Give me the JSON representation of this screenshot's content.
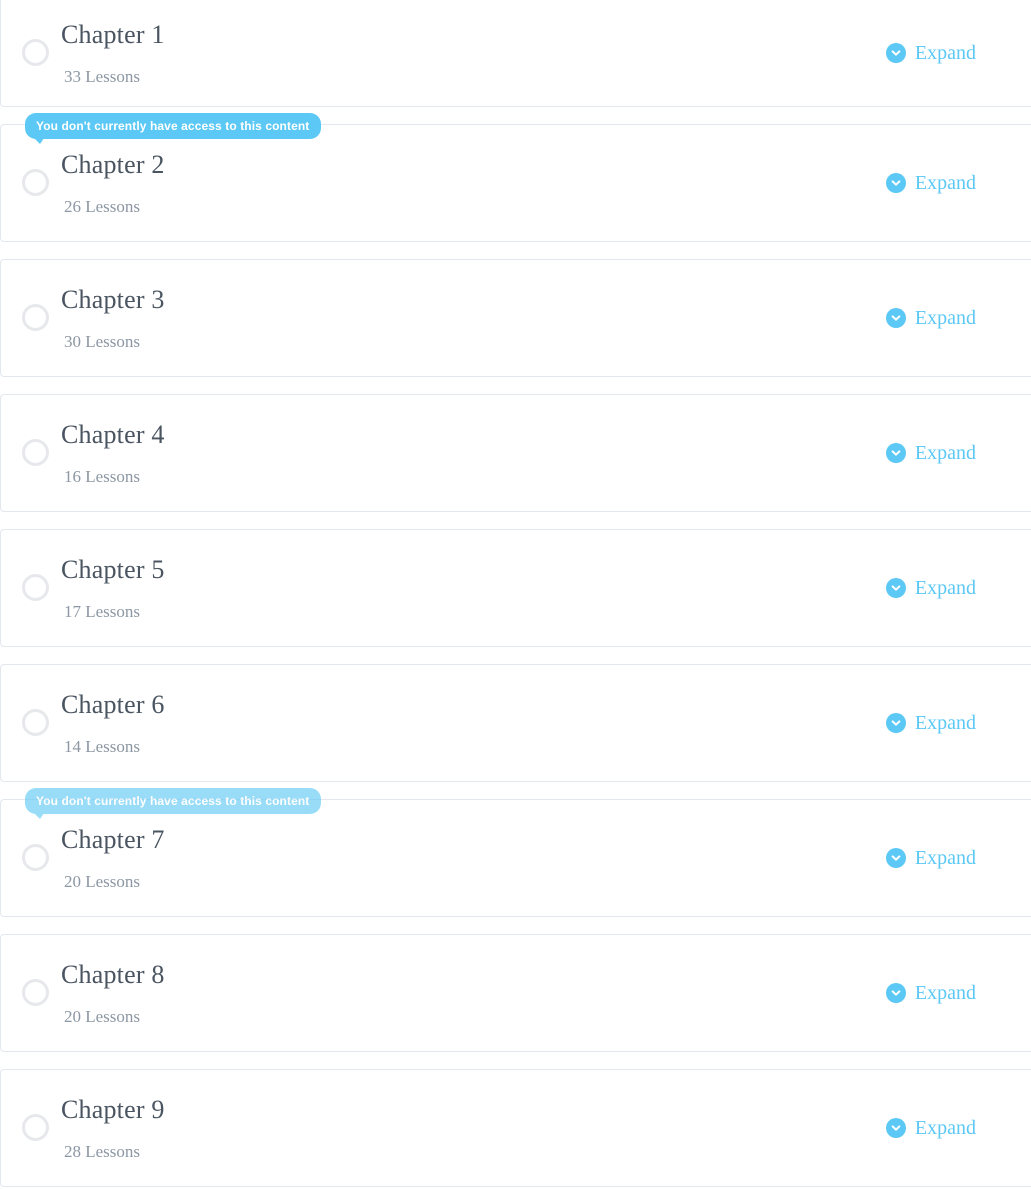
{
  "accordion": {
    "expand_label": "Expand",
    "expand_icon": "chevron-down-circle-icon",
    "status_icon": "progress-circle-incomplete-icon",
    "access_tooltip_text": "You don't currently have access to this content",
    "colors": {
      "accent": "#5bc8f5",
      "title": "#4a5561",
      "meta": "#8c97a3",
      "card_border": "#e3e7ee",
      "circle_ring": "#e6e8ec",
      "background": "#ffffff"
    },
    "chapters": [
      {
        "title": "Chapter 1",
        "lessons": "33 Lessons",
        "locked": false,
        "tooltip_faded": false
      },
      {
        "title": "Chapter 2",
        "lessons": "26 Lessons",
        "locked": true,
        "tooltip_faded": false
      },
      {
        "title": "Chapter 3",
        "lessons": "30 Lessons",
        "locked": false,
        "tooltip_faded": false
      },
      {
        "title": "Chapter 4",
        "lessons": "16 Lessons",
        "locked": false,
        "tooltip_faded": false
      },
      {
        "title": "Chapter 5",
        "lessons": "17 Lessons",
        "locked": false,
        "tooltip_faded": false
      },
      {
        "title": "Chapter 6",
        "lessons": "14 Lessons",
        "locked": false,
        "tooltip_faded": false
      },
      {
        "title": "Chapter 7",
        "lessons": "20 Lessons",
        "locked": true,
        "tooltip_faded": true
      },
      {
        "title": "Chapter 8",
        "lessons": "20 Lessons",
        "locked": false,
        "tooltip_faded": false
      },
      {
        "title": "Chapter 9",
        "lessons": "28 Lessons",
        "locked": false,
        "tooltip_faded": false
      }
    ]
  }
}
